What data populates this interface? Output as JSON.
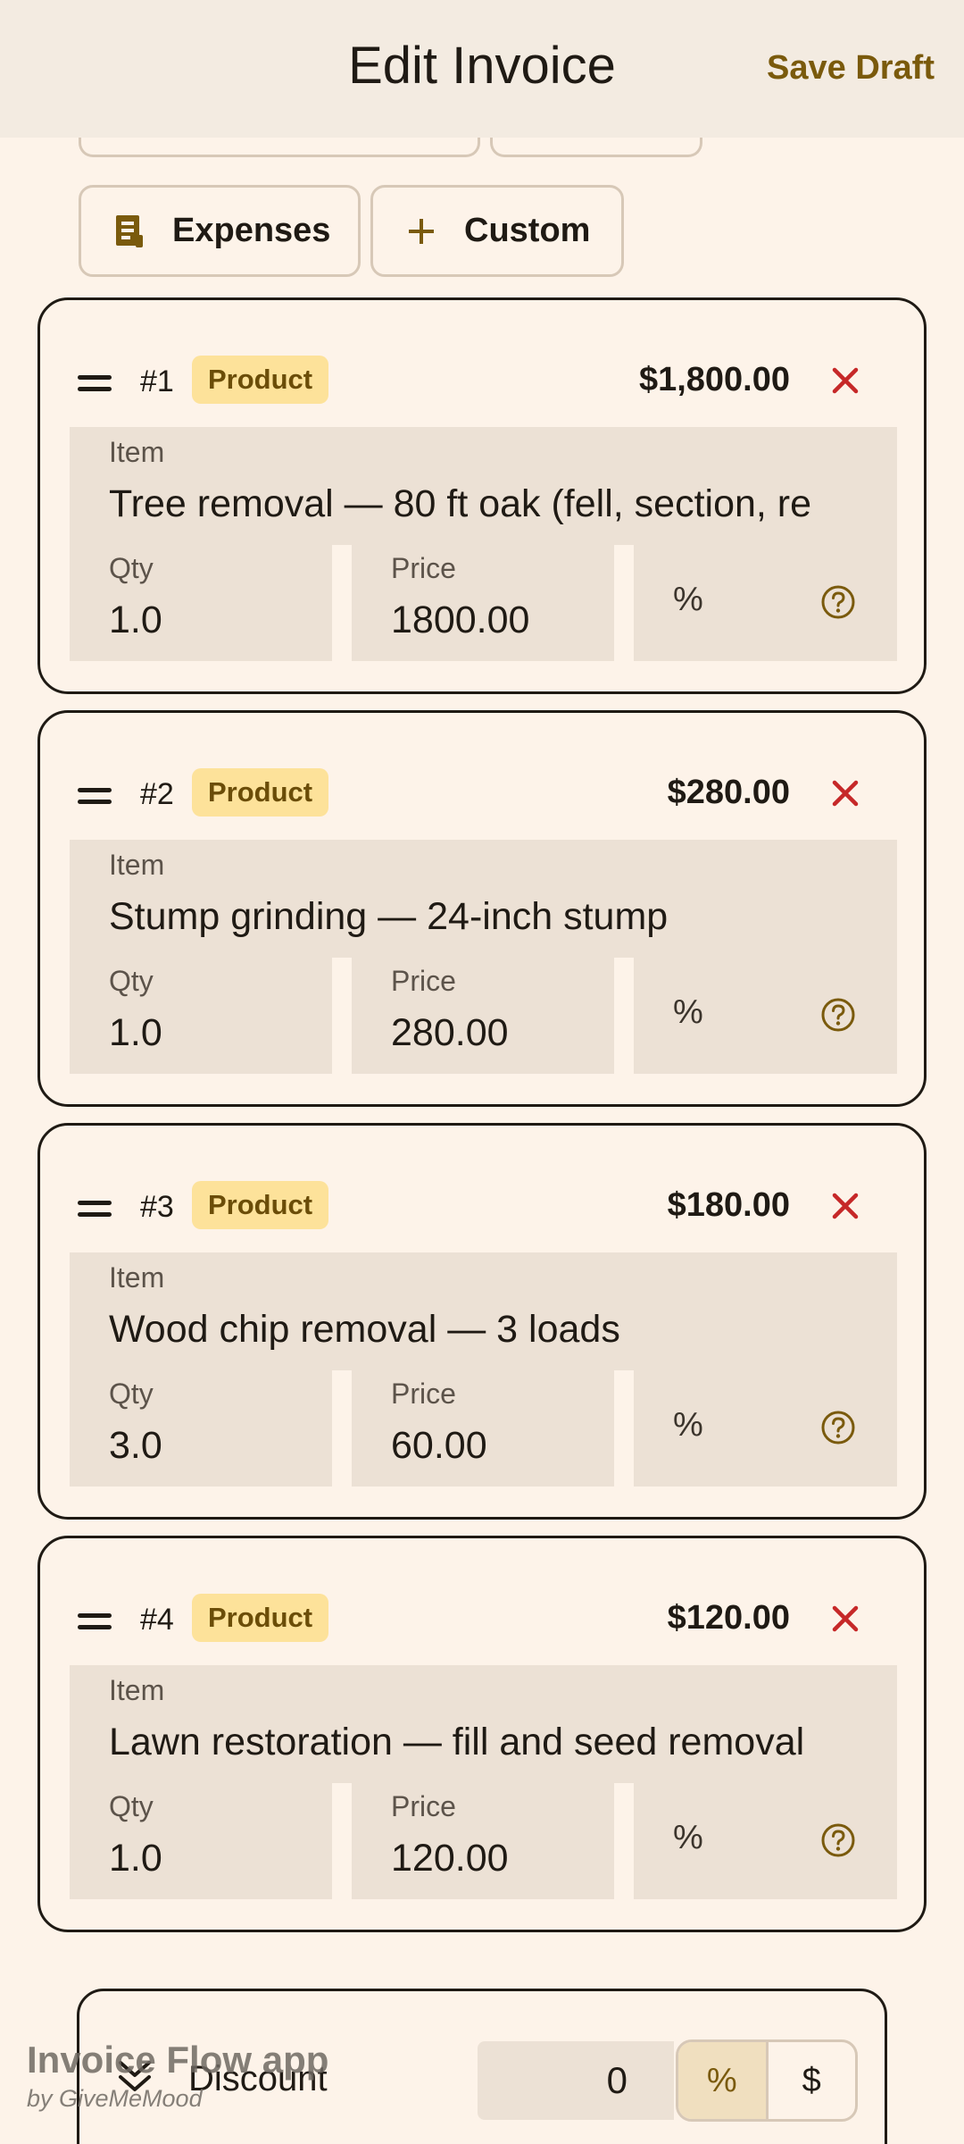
{
  "header": {
    "title": "Edit Invoice",
    "save_label": "Save Draft"
  },
  "chips": {
    "expenses": {
      "label": "Expenses",
      "icon": "receipt-icon"
    },
    "custom": {
      "label": "Custom",
      "icon": "plus-icon"
    }
  },
  "items": [
    {
      "num": "#1",
      "badge": "Product",
      "amount": "$1,800.00",
      "item_label": "Item",
      "item": "Tree removal — 80 ft oak (fell, section, re",
      "qty_label": "Qty",
      "qty": "1.0",
      "price_label": "Price",
      "price": "1800.00",
      "pct": "%"
    },
    {
      "num": "#2",
      "badge": "Product",
      "amount": "$280.00",
      "item_label": "Item",
      "item": "Stump grinding — 24-inch stump",
      "qty_label": "Qty",
      "qty": "1.0",
      "price_label": "Price",
      "price": "280.00",
      "pct": "%"
    },
    {
      "num": "#3",
      "badge": "Product",
      "amount": "$180.00",
      "item_label": "Item",
      "item": "Wood chip removal — 3 loads",
      "qty_label": "Qty",
      "qty": "3.0",
      "price_label": "Price",
      "price": "60.00",
      "pct": "%"
    },
    {
      "num": "#4",
      "badge": "Product",
      "amount": "$120.00",
      "item_label": "Item",
      "item": "Lawn restoration — fill and seed removal",
      "qty_label": "Qty",
      "qty": "1.0",
      "price_label": "Price",
      "price": "120.00",
      "pct": "%"
    }
  ],
  "discount": {
    "label": "Discount",
    "value": "0",
    "percent_option": "%",
    "dollar_option": "$",
    "selected": "%"
  },
  "watermark": {
    "title": "Invoice Flow app",
    "subtitle": "by GiveMeMood"
  },
  "colors": {
    "accent": "#7a5a0c",
    "badge_bg": "#fde29a",
    "delete": "#c62828",
    "field_bg": "#ece1d5"
  }
}
